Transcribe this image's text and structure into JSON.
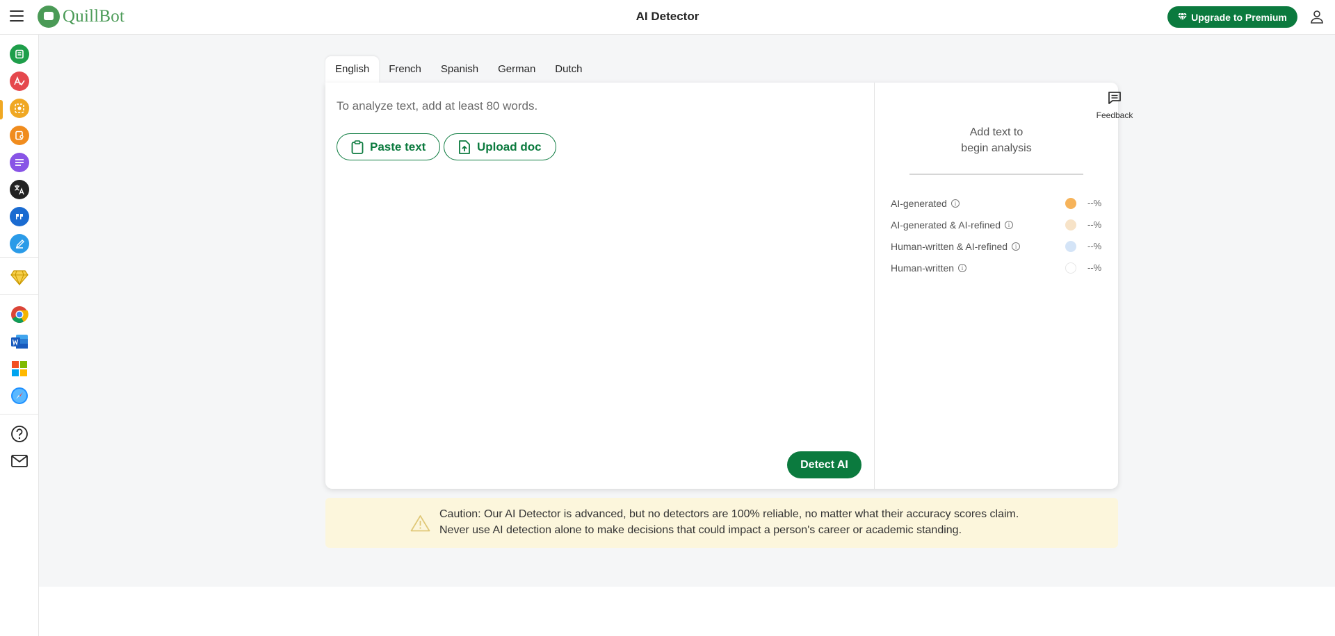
{
  "header": {
    "brand": "QuillBot",
    "title": "AI Detector",
    "upgrade_label": "Upgrade to Premium"
  },
  "sidebar": {
    "items": [
      {
        "name": "paraphraser",
        "color": "#1e9e4a",
        "icon": "paraphraser-icon"
      },
      {
        "name": "grammar-checker",
        "color": "#e5484d",
        "icon": "grammar-checker-icon"
      },
      {
        "name": "ai-detector",
        "color": "#f0a823",
        "icon": "ai-detector-icon",
        "active": true
      },
      {
        "name": "plagiarism-checker",
        "color": "#f08c1e",
        "icon": "plagiarism-icon"
      },
      {
        "name": "summarizer",
        "color": "#8854e6",
        "icon": "summarizer-icon"
      },
      {
        "name": "translator",
        "color": "#222222",
        "icon": "translator-icon"
      },
      {
        "name": "citation-generator",
        "color": "#1a6bd1",
        "icon": "citation-icon"
      },
      {
        "name": "ai-humanizer",
        "color": "#2b9be8",
        "icon": "pen-icon"
      },
      {
        "name": "premium",
        "color": "#e0b400",
        "icon": "diamond-icon"
      },
      {
        "name": "chrome-extension",
        "color": "#4285f4",
        "icon": "chrome-icon"
      },
      {
        "name": "word-addin",
        "color": "#2b579a",
        "icon": "word-icon"
      },
      {
        "name": "microsoft-edge",
        "color": "#f25022",
        "icon": "windows-icon"
      },
      {
        "name": "safari-extension",
        "color": "#1e90ff",
        "icon": "safari-icon"
      },
      {
        "name": "help",
        "color": "#222222",
        "icon": "help-icon"
      },
      {
        "name": "contact",
        "color": "#222222",
        "icon": "mail-icon"
      }
    ]
  },
  "tabs": [
    {
      "label": "English",
      "active": true
    },
    {
      "label": "French"
    },
    {
      "label": "Spanish"
    },
    {
      "label": "German"
    },
    {
      "label": "Dutch"
    }
  ],
  "editor": {
    "placeholder": "To analyze text, add at least 80 words.",
    "paste_label": "Paste text",
    "upload_label": "Upload doc",
    "detect_label": "Detect AI"
  },
  "results": {
    "message_line1": "Add text to",
    "message_line2": "begin analysis",
    "metrics": [
      {
        "label": "AI-generated",
        "value": "--%",
        "color": "#f6b35a"
      },
      {
        "label": "AI-generated & AI-refined",
        "value": "--%",
        "color": "#f7e3c8"
      },
      {
        "label": "Human-written & AI-refined",
        "value": "--%",
        "color": "#d4e4f7"
      },
      {
        "label": "Human-written",
        "value": "--%",
        "color": "#ffffff"
      }
    ]
  },
  "feedback": {
    "label": "Feedback"
  },
  "caution": {
    "line1": "Caution: Our AI Detector is advanced, but no detectors are 100% reliable, no matter what their accuracy scores claim.",
    "line2": "Never use AI detection alone to make decisions that could impact a person's career or academic standing."
  }
}
